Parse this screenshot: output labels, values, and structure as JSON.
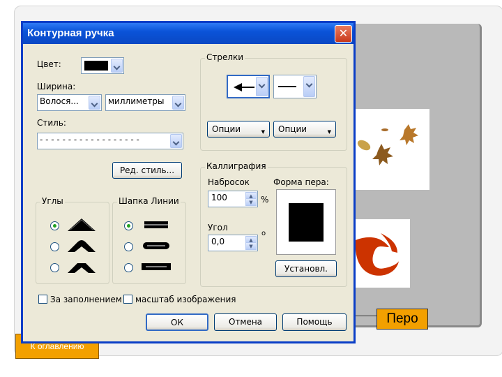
{
  "dialog": {
    "title": "Контурная ручка",
    "color_label": "Цвет:",
    "width_label": "Ширина:",
    "width_value": "Волося...",
    "units_value": "миллиметры",
    "style_label": "Стиль:",
    "style_value": "- - - - - - - - - - - - - - - - - -",
    "edit_style_label": "Ред. стиль...",
    "arrows_group": "Стрелки",
    "options_left": "Опции",
    "options_right": "Опции",
    "calligraphy_group": "Каллиграфия",
    "stretch_label": "Набросок",
    "stretch_value": "100",
    "percent_sign": "%",
    "nib_shape_label": "Форма пера:",
    "angle_label": "Угол",
    "angle_value": "0,0",
    "degree_sign": "o",
    "set_button": "Установл.",
    "corners_group": "Углы",
    "line_caps_group": "Шапка Линии",
    "behind_fill_label": "За заполнением",
    "scale_image_label": "масштаб изображения",
    "ok": "ОК",
    "cancel": "Отмена",
    "help": "Помощь",
    "corners_selected": 0,
    "caps_selected": 0
  },
  "slide": {
    "pen_label": "Перо",
    "toc_button": "К оглавлению"
  },
  "colors": {
    "titlebar": "#0a53d8",
    "dialog_bg": "#ece9d8",
    "orange": "#f3a000",
    "red_image": "#cc3300"
  }
}
